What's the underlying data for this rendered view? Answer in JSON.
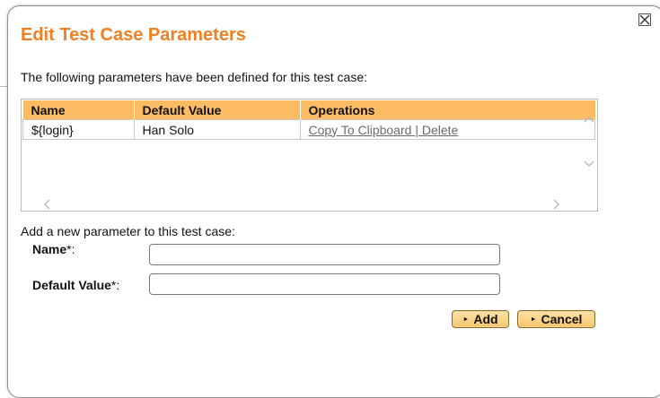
{
  "dialog": {
    "title": "Edit Test Case Parameters",
    "intro": "The following parameters have been defined for this test case:",
    "close_icon": "close-icon"
  },
  "grid": {
    "headers": [
      "Name",
      "Default Value",
      "Operations"
    ],
    "rows": [
      {
        "name": "${login}",
        "default_value": "Han Solo",
        "op_copy": "Copy To Clipboard ",
        "op_sep": "|",
        "op_delete": " Delete"
      }
    ]
  },
  "form": {
    "heading": "Add a new parameter to this test case:",
    "name_label": "Name",
    "default_value_label": "Default Value",
    "required_marker": "*",
    "colon": ":",
    "name_value": "",
    "default_value_value": ""
  },
  "buttons": {
    "add": "Add",
    "cancel": "Cancel",
    "icon": "►"
  },
  "colors": {
    "title": "#f07f22",
    "header_bg": "#fbbc63",
    "button_bg": "#f7c46a"
  }
}
